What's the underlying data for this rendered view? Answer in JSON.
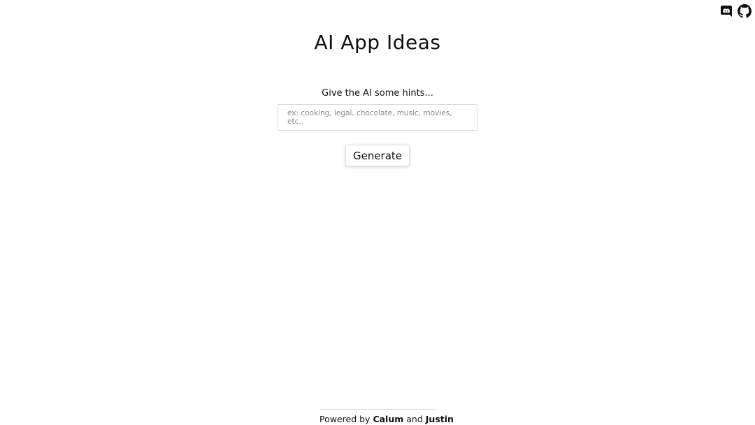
{
  "header": {
    "icons": [
      {
        "name": "discord-icon",
        "label": "Discord"
      },
      {
        "name": "github-icon",
        "label": "GitHub"
      }
    ]
  },
  "main": {
    "title": "AI App Ideas",
    "hint_label": "Give the AI some hints...",
    "hint_input": {
      "value": "",
      "placeholder": "ex: cooking, legal, chocolate, music, movies, etc.."
    },
    "generate_label": "Generate"
  },
  "footer": {
    "prefix": "Powered by",
    "author1": "Calum",
    "conjunction": "and",
    "author2": "Justin"
  },
  "colors": {
    "text": "#111111",
    "background": "#ffffff",
    "border": "#dcdcdc"
  }
}
